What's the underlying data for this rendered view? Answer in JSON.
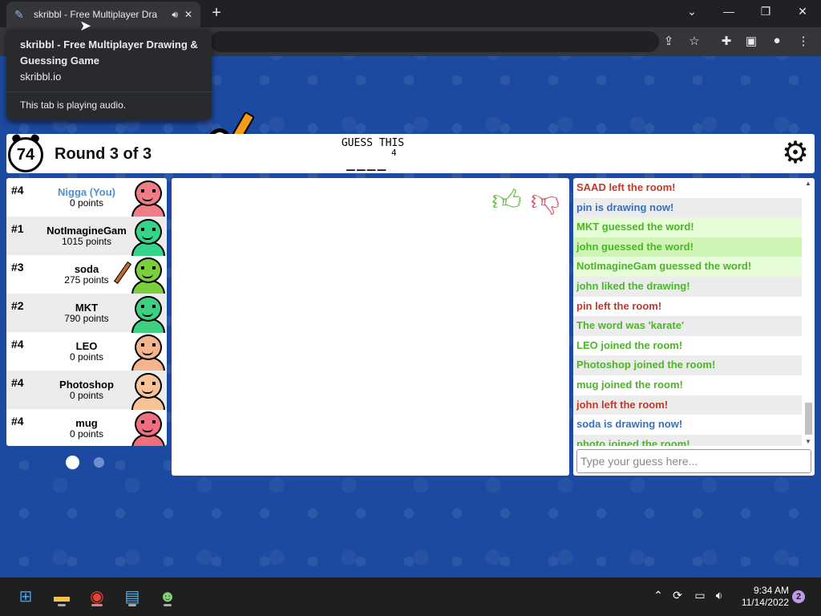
{
  "browser": {
    "tab_title": "skribbl - Free Multiplayer Dra",
    "new_tab": "+",
    "window_controls": {
      "dropdown": "⌄",
      "minimize": "—",
      "restore": "❐",
      "close": "✕"
    },
    "tooltip": {
      "title": "skribbl - Free Multiplayer Drawing & Guessing Game",
      "url": "skribbl.io",
      "audio_note": "This tab is playing audio."
    }
  },
  "game": {
    "timer": "74",
    "round": "Round 3 of 3",
    "guess_label": "GUESS THIS",
    "word_length": "4",
    "word_blanks": "____"
  },
  "players": [
    {
      "rank": "#4",
      "name": "Nigga (You)",
      "points": "0 points",
      "is_you": true,
      "avatar_color": "#f07c86",
      "alt": false
    },
    {
      "rank": "#1",
      "name": "NotImagineGam",
      "points": "1015 points",
      "is_you": false,
      "avatar_color": "#34d48a",
      "alt": true
    },
    {
      "rank": "#3",
      "name": "soda",
      "points": "275 points",
      "is_you": false,
      "avatar_color": "#7ccf3c",
      "alt": false,
      "drawing": true
    },
    {
      "rank": "#2",
      "name": "MKT",
      "points": "790 points",
      "is_you": false,
      "avatar_color": "#3ed080",
      "alt": true
    },
    {
      "rank": "#4",
      "name": "LEO",
      "points": "0 points",
      "is_you": false,
      "avatar_color": "#f4b58c",
      "alt": false
    },
    {
      "rank": "#4",
      "name": "Photoshop",
      "points": "0 points",
      "is_you": false,
      "avatar_color": "#f6c296",
      "alt": true
    },
    {
      "rank": "#4",
      "name": "mug",
      "points": "0 points",
      "is_you": false,
      "avatar_color": "#ef6f7f",
      "alt": false
    }
  ],
  "chat": {
    "messages": [
      {
        "text": "SAAD left the room!",
        "color": "#c0392b",
        "style": "plain"
      },
      {
        "text": "pin is drawing now!",
        "color": "#3b6fb6",
        "style": "odd"
      },
      {
        "text": "MKT guessed the word!",
        "color": "#4cb52a",
        "style": "greenbg"
      },
      {
        "text": "john guessed the word!",
        "color": "#4cb52a",
        "style": "greenbg2"
      },
      {
        "text": "NotImagineGam guessed the word!",
        "color": "#4cb52a",
        "style": "greenbg"
      },
      {
        "text": "john liked the drawing!",
        "color": "#4cb52a",
        "style": "odd"
      },
      {
        "text": "pin left the room!",
        "color": "#c0392b",
        "style": "plain"
      },
      {
        "text": "The word was 'karate'",
        "color": "#4cb52a",
        "style": "odd"
      },
      {
        "text": "LEO joined the room!",
        "color": "#4cb52a",
        "style": "plain"
      },
      {
        "text": "Photoshop joined the room!",
        "color": "#4cb52a",
        "style": "odd"
      },
      {
        "text": "mug joined the room!",
        "color": "#4cb52a",
        "style": "plain"
      },
      {
        "text": "john left the room!",
        "color": "#c0392b",
        "style": "odd"
      },
      {
        "text": "soda is drawing now!",
        "color": "#3b6fb6",
        "style": "plain"
      },
      {
        "text": "photo joined the room!",
        "color": "#4cb52a",
        "style": "odd"
      }
    ],
    "input_placeholder": "Type your guess here..."
  },
  "taskbar": {
    "time": "9:34 AM",
    "date": "11/14/2022",
    "notifications": "2"
  },
  "colors": {
    "page_bg": "#1c4aa0",
    "like_green": "#6fbf4f",
    "dislike_red": "#d9606a"
  }
}
